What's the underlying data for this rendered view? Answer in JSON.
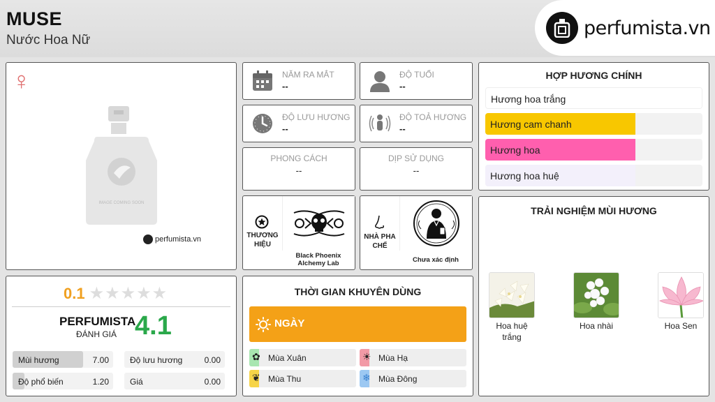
{
  "header": {
    "title": "MUSE",
    "subtitle": "Nước Hoa Nữ",
    "logo_text": "perfumista.vn"
  },
  "product": {
    "gender_symbol": "♀",
    "bottle_caption": "IMAGE COMING SOON",
    "watermark": "perfumista.vn"
  },
  "info": {
    "release_year": {
      "label": "NĂM RA MẮT",
      "value": "--"
    },
    "age": {
      "label": "ĐỘ TUỔI",
      "value": "--"
    },
    "longevity": {
      "label": "ĐỘ LƯU HƯƠNG",
      "value": "--"
    },
    "sillage": {
      "label": "ĐỘ TOẢ HƯƠNG",
      "value": "--"
    },
    "style": {
      "label": "PHONG CÁCH",
      "value": "--"
    },
    "occasion": {
      "label": "DỊP SỬ DỤNG",
      "value": "--"
    },
    "brand": {
      "label": "THƯƠNG HIỆU",
      "name": "Black Phoenix Alchemy Lab"
    },
    "perfumer": {
      "label": "NHÀ PHA CHẾ",
      "name": "Chưa xác định"
    }
  },
  "accords": {
    "title": "HỢP HƯƠNG CHÍNH",
    "items": [
      {
        "label": "Hương hoa trắng",
        "level": 1.0,
        "color": "#ffffff"
      },
      {
        "label": "Hương cam chanh",
        "level": 0.69,
        "color": "#f8c700"
      },
      {
        "label": "Hương hoa",
        "level": 0.69,
        "color": "#ff5fae"
      },
      {
        "label": "Hương hoa huệ",
        "level": 0.69,
        "color": "#f3f0fb"
      }
    ]
  },
  "notes": {
    "title": "TRẢI NGHIỆM MÙI HƯƠNG",
    "items": [
      {
        "label": "Hoa huệ trắng"
      },
      {
        "label": "Hoa nhài"
      },
      {
        "label": "Hoa Sen"
      }
    ]
  },
  "rating": {
    "user_score": "0.1",
    "stars_total": 5,
    "stars_filled": 0,
    "perfumista_label": "PERFUMISTA",
    "perfumista_sub": "ĐÁNH GIÁ",
    "perfumista_score": "4.1",
    "stats": [
      {
        "label": "Mùi hương",
        "value": "7.00",
        "fraction": 0.7
      },
      {
        "label": "Độ lưu hương",
        "value": "0.00",
        "fraction": 0
      },
      {
        "label": "Độ phổ biến",
        "value": "1.20",
        "fraction": 0.12
      },
      {
        "label": "Giá",
        "value": "0.00",
        "fraction": 0
      }
    ]
  },
  "time": {
    "title": "THỜI GIAN KHUYÊN DÙNG",
    "day_label": "NGÀY",
    "seasons": [
      {
        "label": "Mùa Xuân",
        "color": "#a8e6b0"
      },
      {
        "label": "Mùa Hạ",
        "color": "#f29aa6"
      },
      {
        "label": "Mùa Thu",
        "color": "#f6d447"
      },
      {
        "label": "Mùa Đông",
        "color": "#9cc8f2"
      }
    ]
  }
}
